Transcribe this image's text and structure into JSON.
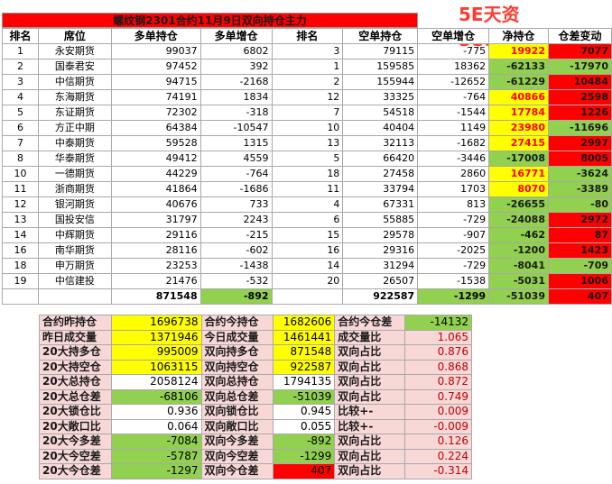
{
  "watermark": "5E天资5etz.com",
  "title": "螺纹钢2301合约11月9日双向持仓主力",
  "headers": [
    "排名",
    "席位",
    "多单持仓",
    "多单增仓",
    "排名",
    "空单持仓",
    "空单增仓",
    "净持仓",
    "仓差变动"
  ],
  "rows": [
    [
      "1",
      "永安期货",
      "99037",
      "6802",
      "3",
      "79115",
      "-775",
      "19922",
      "7077"
    ],
    [
      "2",
      "国泰君安",
      "97452",
      "392",
      "1",
      "159585",
      "18362",
      "-62133",
      "-17970"
    ],
    [
      "3",
      "中信期货",
      "94715",
      "-2168",
      "2",
      "155944",
      "-12652",
      "-61229",
      "10484"
    ],
    [
      "4",
      "东海期货",
      "74191",
      "1834",
      "12",
      "33325",
      "-764",
      "40866",
      "2598"
    ],
    [
      "5",
      "东证期货",
      "72302",
      "-318",
      "7",
      "54518",
      "-1544",
      "17784",
      "1226"
    ],
    [
      "6",
      "方正中期",
      "64384",
      "-10547",
      "10",
      "40404",
      "1149",
      "23980",
      "-11696"
    ],
    [
      "7",
      "中泰期货",
      "59528",
      "1315",
      "13",
      "32113",
      "-1682",
      "27415",
      "2997"
    ],
    [
      "8",
      "华泰期货",
      "49412",
      "4559",
      "5",
      "66420",
      "-3446",
      "-17008",
      "8005"
    ],
    [
      "10",
      "一德期货",
      "44229",
      "-764",
      "18",
      "27458",
      "2860",
      "16771",
      "-3624"
    ],
    [
      "11",
      "浙商期货",
      "41864",
      "-1686",
      "11",
      "33794",
      "1703",
      "8070",
      "-3389"
    ],
    [
      "12",
      "银河期货",
      "40676",
      "733",
      "4",
      "67331",
      "813",
      "-26655",
      "-80"
    ],
    [
      "13",
      "国投安信",
      "31797",
      "2243",
      "6",
      "55885",
      "-729",
      "-24088",
      "2972"
    ],
    [
      "14",
      "中辉期货",
      "29116",
      "-215",
      "15",
      "29578",
      "-907",
      "-462",
      "87"
    ],
    [
      "16",
      "南华期货",
      "28116",
      "-602",
      "16",
      "29316",
      "-2025",
      "-1200",
      "1423"
    ],
    [
      "18",
      "申万期货",
      "23253",
      "-1438",
      "14",
      "31294",
      "-729",
      "-8041",
      "-709"
    ],
    [
      "19",
      "中信建投",
      "21476",
      "-532",
      "20",
      "26507",
      "-1538",
      "-5031",
      "1006"
    ]
  ],
  "totals": {
    "long": "871548",
    "long_chg": "-892",
    "short": "922587",
    "short_chg": "-1299",
    "net": "-51039",
    "diff": "407"
  },
  "summary": [
    [
      "合约昨持仓",
      "1696738",
      "合约今持仓",
      "1682606",
      "合约今仓差",
      "-14132"
    ],
    [
      "昨日成交量",
      "1371946",
      "今日成交量",
      "1461441",
      "成交量比",
      "1.065"
    ],
    [
      "20大持多仓",
      "995009",
      "双向持多仓",
      "871548",
      "双向占比",
      "0.876"
    ],
    [
      "20大持空仓",
      "1063115",
      "双向持空仓",
      "922587",
      "双向占比",
      "0.868"
    ],
    [
      "20大总持仓",
      "2058124",
      "双向总持仓",
      "1794135",
      "双向占比",
      "0.872"
    ],
    [
      "20大总仓差",
      "-68106",
      "双向总仓差",
      "-51039",
      "双向占比",
      "0.749"
    ],
    [
      "20大锁仓比",
      "0.936",
      "双向锁仓比",
      "0.945",
      "比较+-",
      "0.009"
    ],
    [
      "20大敞口比",
      "0.064",
      "双向敞口比",
      "0.055",
      "比较+-",
      "-0.009"
    ],
    [
      "20大今多差",
      "-7084",
      "双向今多差",
      "-892",
      "双向占比",
      "0.126"
    ],
    [
      "20大今空差",
      "-5787",
      "双向今空差",
      "-1299",
      "双向占比",
      "0.224"
    ],
    [
      "20大今仓差",
      "-1297",
      "双向今仓差",
      "407",
      "双向占比",
      "-0.314"
    ]
  ]
}
